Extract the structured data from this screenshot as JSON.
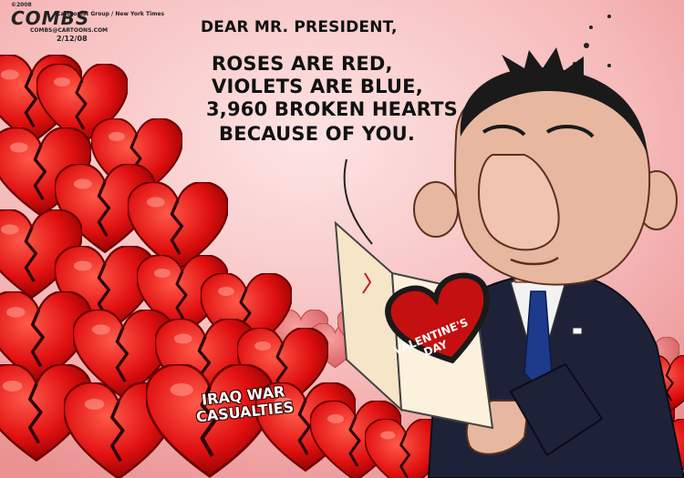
{
  "signature": {
    "copyright": "©2008",
    "artist": "COMBS",
    "publisher_line": "Cartoonist Group / New York Times",
    "small_text": "COMBS@CARTOONS.COM",
    "date": "2/12/08"
  },
  "caption": {
    "greeting": "DEAR MR. PRESIDENT,",
    "line1": "ROSES ARE RED,",
    "line2": "VIOLETS ARE BLUE,",
    "line3": "3,960 BROKEN HEARTS",
    "line4": "BECAUSE OF YOU."
  },
  "card": {
    "line1": "VALENTINE'S",
    "line2": "DAY"
  },
  "pile_label": {
    "line1": "IRAQ WAR",
    "line2": "CASUALTIES"
  },
  "colors": {
    "heart_red": "#e01010",
    "heart_shadow": "#8a0000",
    "background": "#f6c2c2",
    "suit": "#1e2238",
    "tie": "#1e3a8a",
    "skin": "#e8b7a0",
    "card": "#fbf1dc"
  }
}
